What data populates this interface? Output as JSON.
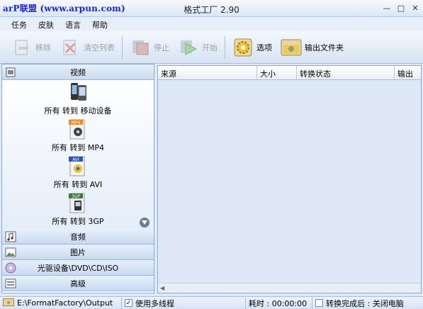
{
  "titlebar": {
    "watermark": "arP联盟 (www.arpun.com)",
    "title": "格式工厂 2.90",
    "minimize": "—",
    "maximize": "□",
    "close": "✕"
  },
  "menu": [
    "任务",
    "皮肤",
    "语言",
    "帮助"
  ],
  "toolbar": {
    "remove": "移除",
    "clear_list": "清空列表",
    "stop": "停止",
    "start": "开始",
    "options": "选项",
    "output_folder": "输出文件夹"
  },
  "left_panel": {
    "video_header": "视频",
    "video_items": [
      {
        "label": "所有  转到  移动设备",
        "icon": "mobile-devices-icon"
      },
      {
        "label": "所有  转到  MP4",
        "icon": "mp4-file-icon",
        "badge": "MP4"
      },
      {
        "label": "所有  转到  AVI",
        "icon": "avi-file-icon",
        "badge": "AVI"
      },
      {
        "label": "所有  转到  3GP",
        "icon": "3gp-file-icon",
        "badge": "3GP"
      }
    ],
    "categories": [
      "音频",
      "图片",
      "光驱设备\\DVD\\CD\\ISO",
      "高级"
    ]
  },
  "table": {
    "columns": [
      "来源",
      "大小",
      "转换状态",
      "输出"
    ]
  },
  "statusbar": {
    "output_path": "E:\\FormatFactory\\Output",
    "multithread_label": "使用多线程",
    "multithread_checked": true,
    "elapsed_label": "耗时 : 00:00:00",
    "after_convert_label": "转换完成后 : 关闭电脑"
  },
  "colors": {
    "watermark": "#1a27c9",
    "accent_border": "#8fa9cf",
    "panel_bg": "#dfe8f6"
  }
}
